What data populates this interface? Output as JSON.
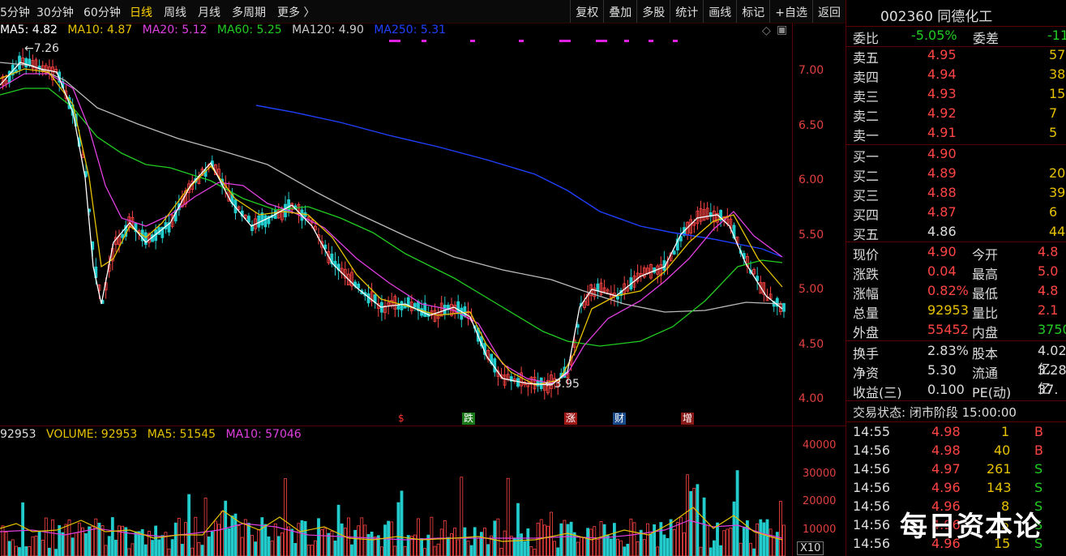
{
  "toolbar": {
    "periods": [
      {
        "label": "5分钟",
        "active": false
      },
      {
        "label": "30分钟",
        "active": false
      },
      {
        "label": "60分钟",
        "active": false
      },
      {
        "label": "日线",
        "active": true
      },
      {
        "label": "周线",
        "active": false
      },
      {
        "label": "月线",
        "active": false
      },
      {
        "label": "多周期",
        "active": false
      },
      {
        "label": "更多 〉",
        "active": false
      }
    ],
    "buttons": [
      "复权",
      "叠加",
      "多股",
      "统计",
      "画线",
      "标记",
      "+自选",
      "返回"
    ]
  },
  "ma_legend": [
    {
      "label": "MA5: 4.82",
      "color": "#ffffff"
    },
    {
      "label": "MA10: 4.87",
      "color": "#e6c200"
    },
    {
      "label": "MA20: 5.12",
      "color": "#e040e0"
    },
    {
      "label": "MA60: 5.25",
      "color": "#22cc22"
    },
    {
      "label": "MA120: 4.90",
      "color": "#cccccc"
    },
    {
      "label": "MA250: 5.31",
      "color": "#2040ff"
    }
  ],
  "price_axis": [
    "7.00",
    "6.50",
    "6.00",
    "5.50",
    "5.00",
    "4.50",
    "4.00"
  ],
  "annotations": {
    "high": "7.26",
    "low": "3.95"
  },
  "event_markers": [
    {
      "label": "$",
      "color": "#ff3333",
      "bg": "transparent"
    },
    {
      "label": "跌",
      "color": "#ffffff",
      "bg": "#1a7a1a"
    },
    {
      "label": "涨",
      "color": "#ffffff",
      "bg": "#a01818"
    },
    {
      "label": "财",
      "color": "#ffffff",
      "bg": "#1a4a8a"
    },
    {
      "label": "增",
      "color": "#ffffff",
      "bg": "#8a1a1a"
    }
  ],
  "volume_legend": [
    {
      "label": "92953",
      "color": "#dddddd"
    },
    {
      "label": "VOLUME: 92953",
      "color": "#e6c200"
    },
    {
      "label": "MA5: 51545",
      "color": "#e6c200"
    },
    {
      "label": "MA10: 57046",
      "color": "#e040e0"
    }
  ],
  "volume_axis": [
    "40000",
    "30000",
    "20000",
    "10000"
  ],
  "volume_unit": "X10",
  "quote": {
    "title": "002360 同德化工",
    "weibi_label": "委比",
    "weibi_value": "-5.05%",
    "weicha_label": "委差",
    "weicha_value": "-11",
    "asks": [
      {
        "label": "卖五",
        "price": "4.95",
        "vol": "57"
      },
      {
        "label": "卖四",
        "price": "4.94",
        "vol": "38"
      },
      {
        "label": "卖三",
        "price": "4.93",
        "vol": "15"
      },
      {
        "label": "卖二",
        "price": "4.92",
        "vol": "7"
      },
      {
        "label": "卖一",
        "price": "4.91",
        "vol": "5"
      }
    ],
    "bids": [
      {
        "label": "买一",
        "price": "4.90",
        "vol": ""
      },
      {
        "label": "买二",
        "price": "4.89",
        "vol": "20"
      },
      {
        "label": "买三",
        "price": "4.88",
        "vol": "39"
      },
      {
        "label": "买四",
        "price": "4.87",
        "vol": "6"
      },
      {
        "label": "买五",
        "price": "4.86",
        "vol": "44"
      }
    ],
    "stats": [
      {
        "l1": "现价",
        "v1": "4.90",
        "l2": "今开",
        "v2": "4.8"
      },
      {
        "l1": "涨跌",
        "v1": "0.04",
        "l2": "最高",
        "v2": "5.0"
      },
      {
        "l1": "涨幅",
        "v1": "0.82%",
        "l2": "最低",
        "v2": "4.8"
      },
      {
        "l1": "总量",
        "v1": "92953",
        "l2": "量比",
        "v2": "2.1"
      },
      {
        "l1": "外盘",
        "v1": "55452",
        "l2": "内盘",
        "v2": "3750"
      }
    ],
    "fundamentals": [
      {
        "l1": "换手",
        "v1": "2.83%",
        "l2": "股本",
        "v2": "4.02亿"
      },
      {
        "l1": "净资",
        "v1": "5.30",
        "l2": "流通",
        "v2": "3.28亿"
      },
      {
        "l1": "收益(三)",
        "v1": "0.100",
        "l2": "PE(动)",
        "v2": "37."
      }
    ],
    "trade_status": "交易状态: 闭市阶段 15:00:00",
    "ticks": [
      {
        "time": "14:55",
        "price": "4.98",
        "vol": "1",
        "side": "B"
      },
      {
        "time": "14:56",
        "price": "4.98",
        "vol": "40",
        "side": "B"
      },
      {
        "time": "14:56",
        "price": "4.97",
        "vol": "261",
        "side": "S"
      },
      {
        "time": "14:56",
        "price": "4.96",
        "vol": "143",
        "side": "S"
      },
      {
        "time": "14:56",
        "price": "4.96",
        "vol": "8",
        "side": "S"
      },
      {
        "time": "14:56",
        "price": "4.96",
        "vol": "5",
        "side": "S"
      },
      {
        "time": "14:56",
        "price": "4.96",
        "vol": "15",
        "side": "S"
      }
    ]
  },
  "watermark": "每日资本论",
  "colors": {
    "up": "#ff4444",
    "down": "#22cccc",
    "bg": "#000000",
    "grid": "#5a0000"
  }
}
